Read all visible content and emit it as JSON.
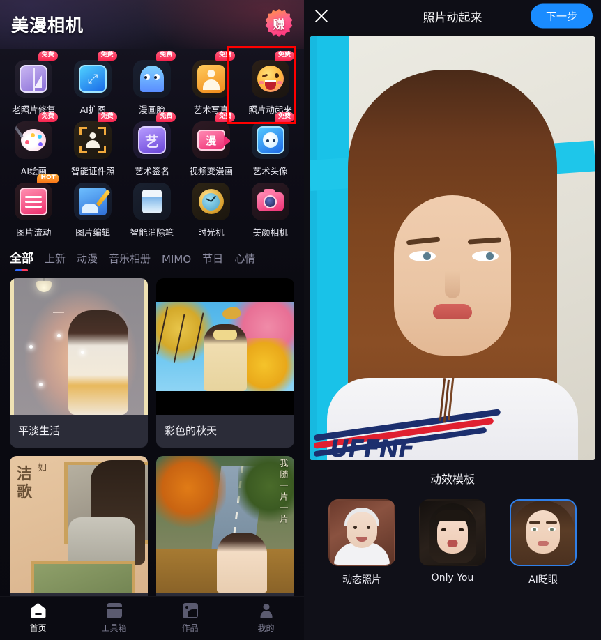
{
  "left": {
    "header": {
      "app_title": "美漫相机",
      "earn_badge_char": "赚",
      "earn_badge_icon": "earn-starburst-icon"
    },
    "tools": [
      [
        {
          "label": "老照片修复",
          "tag": "免费",
          "tag_type": "free",
          "icon": "old-photo-restore-icon"
        },
        {
          "label": "AI扩图",
          "tag": "免费",
          "tag_type": "free",
          "icon": "ai-expand-icon"
        },
        {
          "label": "漫画脸",
          "tag": "免费",
          "tag_type": "free",
          "icon": "comic-face-ghost-icon"
        },
        {
          "label": "艺术写真",
          "tag": "免费",
          "tag_type": "free",
          "icon": "art-portrait-icon"
        },
        {
          "label": "照片动起来",
          "tag": "免费",
          "tag_type": "free",
          "icon": "animate-photo-emoji-icon"
        }
      ],
      [
        {
          "label": "AI绘画",
          "tag": "免费",
          "tag_type": "free",
          "icon": "ai-painting-palette-icon"
        },
        {
          "label": "智能证件照",
          "tag": "免费",
          "tag_type": "free",
          "icon": "id-photo-icon"
        },
        {
          "label": "艺术签名",
          "tag": "免费",
          "tag_type": "free",
          "icon": "art-signature-icon"
        },
        {
          "label": "视频变漫画",
          "tag": "免费",
          "tag_type": "free",
          "icon": "video-to-comic-icon"
        },
        {
          "label": "艺术头像",
          "tag": "免费",
          "tag_type": "free",
          "icon": "art-avatar-icon"
        }
      ],
      [
        {
          "label": "图片流动",
          "tag": "HOT",
          "tag_type": "hot",
          "icon": "photo-flow-icon"
        },
        {
          "label": "图片编辑",
          "tag": "",
          "tag_type": "",
          "icon": "photo-edit-icon"
        },
        {
          "label": "智能消除笔",
          "tag": "",
          "tag_type": "",
          "icon": "smart-eraser-icon"
        },
        {
          "label": "时光机",
          "tag": "",
          "tag_type": "",
          "icon": "time-machine-clock-icon"
        },
        {
          "label": "美颜相机",
          "tag": "",
          "tag_type": "",
          "icon": "beauty-camera-icon"
        }
      ]
    ],
    "tabs": [
      {
        "label": "全部",
        "active": true
      },
      {
        "label": "上新",
        "active": false
      },
      {
        "label": "动漫",
        "active": false
      },
      {
        "label": "音乐相册",
        "active": false
      },
      {
        "label": "MIMO",
        "active": false
      },
      {
        "label": "节日",
        "active": false
      },
      {
        "label": "心情",
        "active": false
      }
    ],
    "cards": [
      {
        "title": "平淡生活"
      },
      {
        "title": "彩色的秋天"
      },
      {
        "title": ""
      },
      {
        "title": ""
      }
    ],
    "card_art": {
      "road_vertical_text": "我随一片一片"
    },
    "bottom_nav": [
      {
        "label": "首页",
        "icon": "home-icon",
        "active": true
      },
      {
        "label": "工具箱",
        "icon": "toolbox-icon",
        "active": false
      },
      {
        "label": "作品",
        "icon": "works-image-icon",
        "active": false
      },
      {
        "label": "我的",
        "icon": "person-icon",
        "active": false
      }
    ],
    "highlight": {
      "color": "#ff0000",
      "target": "照片动起来"
    }
  },
  "right": {
    "header": {
      "close_icon": "close-x-icon",
      "title": "照片动起来",
      "next_label": "下一步",
      "next_color": "#1a8cff"
    },
    "preview": {
      "shirt_wordmark": "UFFNF"
    },
    "templates_title": "动效模板",
    "templates": [
      {
        "label": "动态照片",
        "selected": false
      },
      {
        "label": "Only You",
        "selected": false
      },
      {
        "label": "AI眨眼",
        "selected": true
      }
    ],
    "selected_border_color": "#2f7fe8"
  }
}
